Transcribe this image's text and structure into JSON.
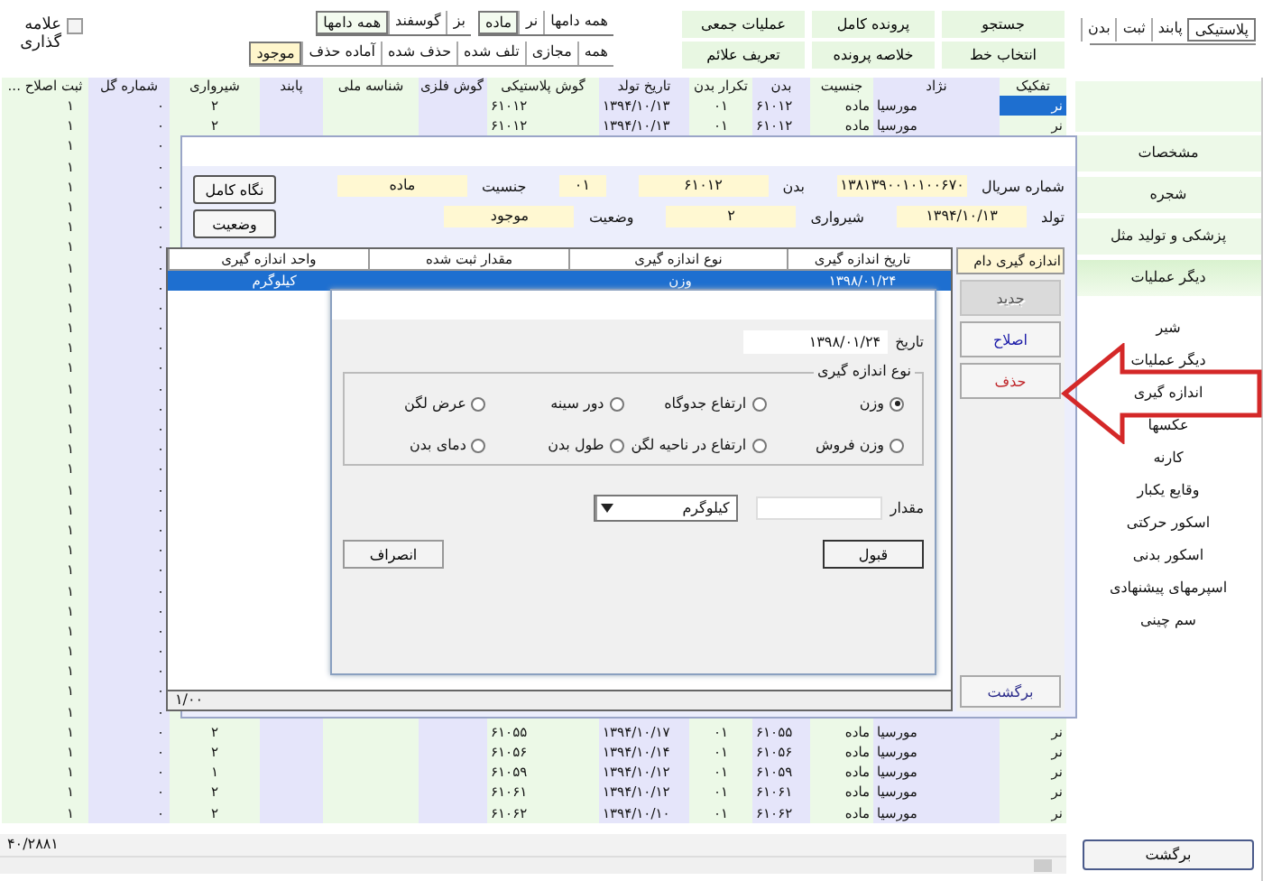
{
  "mark_option": {
    "label": "علامه گذاری",
    "checked": false
  },
  "filter_groups": [
    [
      {
        "label": "همه دامها",
        "selected": false
      },
      {
        "label": "نر",
        "selected": false
      },
      {
        "label": "ماده",
        "selected": true
      }
    ],
    [
      {
        "label": "بز",
        "selected": false
      },
      {
        "label": "گوسفند",
        "selected": false
      },
      {
        "label": "همه دامها",
        "selected": true
      }
    ]
  ],
  "status_tabs": [
    {
      "label": "همه",
      "selected": false
    },
    {
      "label": "مجازی",
      "selected": false
    },
    {
      "label": "تلف شده",
      "selected": false
    },
    {
      "label": "حذف شده",
      "selected": false
    },
    {
      "label": "آماده حذف",
      "selected": false
    },
    {
      "label": "موجود",
      "selected": true
    }
  ],
  "actions": [
    "جستجو",
    "پرونده کامل",
    "عملیات جمعی",
    "انتخاب خط",
    "خلاصه پرونده",
    "تعریف علائم"
  ],
  "view_tabs": [
    {
      "label": "پلاستیکی",
      "selected": true
    },
    {
      "label": "پابند",
      "selected": false
    },
    {
      "label": "ثبت",
      "selected": false
    },
    {
      "label": "بدن",
      "selected": false
    }
  ],
  "grid": {
    "columns": [
      "تفکیک",
      "نژاد",
      "جنسیت",
      "بدن",
      "تکرار بدن",
      "تاریخ تولد",
      "گوش پلاستیکی",
      "گوش فلزی",
      "شناسه ملی",
      "پابند",
      "شیرواری",
      "شماره گل",
      "ثبت اصلاح ..."
    ],
    "rows": [
      {
        "selected": true,
        "cells": [
          "نر",
          "مورسیا",
          "ماده",
          "۶۱۰۱۲",
          "۰۱",
          "۱۳۹۴/۱۰/۱۳",
          "۶۱۰۱۲",
          null,
          null,
          null,
          "۲",
          "۰",
          "۱"
        ]
      },
      {
        "selected": false,
        "cells": [
          "نر",
          "مورسیا",
          "ماده",
          "۶۱۰۱۲",
          "۰۱",
          "۱۳۹۴/۱۰/۱۳",
          "۶۱۰۱۲",
          null,
          null,
          null,
          "۲",
          "۰",
          "۱"
        ]
      },
      {
        "cells": [
          null,
          null,
          null,
          null,
          null,
          null,
          null,
          null,
          null,
          null,
          null,
          "۰",
          "۱"
        ]
      },
      {
        "cells": [
          null,
          null,
          null,
          null,
          null,
          null,
          null,
          null,
          null,
          null,
          null,
          "۰",
          "۱"
        ]
      },
      {
        "cells": [
          null,
          null,
          null,
          null,
          null,
          null,
          null,
          null,
          null,
          null,
          null,
          "۰",
          "۱"
        ]
      },
      {
        "cells": [
          null,
          null,
          null,
          null,
          null,
          null,
          null,
          null,
          null,
          null,
          null,
          "۰",
          "۱"
        ]
      },
      {
        "cells": [
          null,
          null,
          null,
          null,
          null,
          null,
          null,
          null,
          null,
          null,
          null,
          "۰",
          "۱"
        ]
      },
      {
        "cells": [
          null,
          null,
          null,
          null,
          null,
          null,
          null,
          null,
          null,
          null,
          null,
          "۰",
          "۱"
        ]
      },
      {
        "cells": [
          null,
          null,
          null,
          null,
          null,
          null,
          null,
          null,
          null,
          null,
          null,
          "۰",
          "۱"
        ]
      },
      {
        "cells": [
          null,
          null,
          null,
          null,
          null,
          null,
          null,
          null,
          null,
          null,
          null,
          "۰",
          "۱"
        ]
      },
      {
        "cells": [
          null,
          null,
          null,
          null,
          null,
          null,
          null,
          null,
          null,
          null,
          null,
          "۰",
          "۱"
        ]
      },
      {
        "cells": [
          null,
          null,
          null,
          null,
          null,
          null,
          null,
          null,
          null,
          null,
          null,
          "۰",
          "۱"
        ]
      },
      {
        "cells": [
          null,
          null,
          null,
          null,
          null,
          null,
          null,
          null,
          null,
          null,
          null,
          "۰",
          "۱"
        ]
      },
      {
        "cells": [
          null,
          null,
          null,
          null,
          null,
          null,
          null,
          null,
          null,
          null,
          null,
          "۰",
          "۱"
        ]
      },
      {
        "cells": [
          null,
          null,
          null,
          null,
          null,
          null,
          null,
          null,
          null,
          null,
          null,
          "۰",
          "۱"
        ]
      },
      {
        "cells": [
          null,
          null,
          null,
          null,
          null,
          null,
          null,
          null,
          null,
          null,
          null,
          "۰",
          "۱"
        ]
      },
      {
        "cells": [
          null,
          null,
          null,
          null,
          null,
          null,
          null,
          null,
          null,
          null,
          null,
          "۰",
          "۱"
        ]
      },
      {
        "cells": [
          null,
          null,
          null,
          null,
          null,
          null,
          null,
          null,
          null,
          null,
          null,
          "۰",
          "۱"
        ]
      },
      {
        "cells": [
          null,
          null,
          null,
          null,
          null,
          null,
          null,
          null,
          null,
          null,
          null,
          "۰",
          "۱"
        ]
      },
      {
        "cells": [
          null,
          null,
          null,
          null,
          null,
          null,
          null,
          null,
          null,
          null,
          null,
          "۰",
          "۱"
        ]
      },
      {
        "cells": [
          null,
          null,
          null,
          null,
          null,
          null,
          null,
          null,
          null,
          null,
          null,
          "۰",
          "۱"
        ]
      },
      {
        "cells": [
          null,
          null,
          null,
          null,
          null,
          null,
          null,
          null,
          null,
          null,
          null,
          "۰",
          "۱"
        ]
      },
      {
        "cells": [
          null,
          null,
          null,
          null,
          null,
          null,
          null,
          null,
          null,
          null,
          null,
          "۰",
          "۱"
        ]
      },
      {
        "cells": [
          null,
          null,
          null,
          null,
          null,
          null,
          null,
          null,
          null,
          null,
          null,
          "۰",
          "۱"
        ]
      },
      {
        "cells": [
          null,
          null,
          null,
          null,
          null,
          null,
          null,
          null,
          null,
          null,
          null,
          "۰",
          "۱"
        ]
      },
      {
        "cells": [
          null,
          null,
          null,
          null,
          null,
          null,
          null,
          null,
          null,
          null,
          null,
          "۰",
          "۱"
        ]
      },
      {
        "cells": [
          null,
          null,
          null,
          null,
          null,
          null,
          null,
          null,
          null,
          null,
          null,
          "۰",
          "۱"
        ]
      },
      {
        "cells": [
          null,
          null,
          null,
          null,
          null,
          null,
          null,
          null,
          null,
          null,
          null,
          "۰",
          "۱"
        ]
      },
      {
        "cells": [
          null,
          null,
          null,
          null,
          null,
          null,
          null,
          null,
          null,
          null,
          null,
          "۰",
          "۱"
        ]
      },
      {
        "cells": [
          null,
          null,
          null,
          null,
          null,
          null,
          null,
          null,
          null,
          null,
          null,
          "۰",
          "۱"
        ]
      },
      {
        "cells": [
          null,
          null,
          null,
          null,
          null,
          null,
          null,
          null,
          null,
          null,
          null,
          "۰",
          "۱"
        ]
      },
      {
        "selected": false,
        "cells": [
          "نر",
          "مورسیا",
          "ماده",
          "۶۱۰۵۵",
          "۰۱",
          "۱۳۹۴/۱۰/۱۷",
          "۶۱۰۵۵",
          null,
          null,
          null,
          "۲",
          "۰",
          "۱"
        ]
      },
      {
        "selected": false,
        "cells": [
          "نر",
          "مورسیا",
          "ماده",
          "۶۱۰۵۶",
          "۰۱",
          "۱۳۹۴/۱۰/۱۴",
          "۶۱۰۵۶",
          null,
          null,
          null,
          "۲",
          "۰",
          "۱"
        ]
      },
      {
        "selected": false,
        "cells": [
          "نر",
          "مورسیا",
          "ماده",
          "۶۱۰۵۹",
          "۰۱",
          "۱۳۹۴/۱۰/۱۲",
          "۶۱۰۵۹",
          null,
          null,
          null,
          "۱",
          "۰",
          "۱"
        ]
      },
      {
        "selected": false,
        "cells": [
          "نر",
          "مورسیا",
          "ماده",
          "۶۱۰۶۱",
          "۰۱",
          "۱۳۹۴/۱۰/۱۲",
          "۶۱۰۶۱",
          null,
          null,
          null,
          "۲",
          "۰",
          "۱"
        ]
      },
      {
        "selected": false,
        "cells": [
          "نر",
          "مورسیا",
          "ماده",
          "۶۱۰۶۲",
          "۰۱",
          "۱۳۹۴/۱۰/۱۰",
          "۶۱۰۶۲",
          null,
          null,
          null,
          "۲",
          "۰",
          "۱"
        ]
      }
    ]
  },
  "record_count": "۴۰/۲۸۸۱",
  "sidebar": [
    {
      "kind": "section",
      "label": "مشخصات",
      "selected": false
    },
    {
      "kind": "section",
      "label": "شجره",
      "selected": false
    },
    {
      "kind": "section",
      "label": "پزشکی و تولید مثل",
      "selected": false
    },
    {
      "kind": "section",
      "label": "دیگر عملیات",
      "selected": true
    },
    {
      "kind": "item",
      "label": "شیر"
    },
    {
      "kind": "item",
      "label": "دیگر عملیات"
    },
    {
      "kind": "item",
      "label": "اندازه گیری"
    },
    {
      "kind": "item",
      "label": "عکسها"
    },
    {
      "kind": "item",
      "label": "کارنه"
    },
    {
      "kind": "item",
      "label": "وقایع یکبار"
    },
    {
      "kind": "item",
      "label": "اسکور حرکتی"
    },
    {
      "kind": "item",
      "label": "اسکور بدنی"
    },
    {
      "kind": "item",
      "label": "اسپرمهای پیشنهادی"
    },
    {
      "kind": "item",
      "label": "سم چینی"
    }
  ],
  "back_button": "برگشت",
  "dialog": {
    "fields": [
      [
        {
          "label": "شماره سریال",
          "value": "۱۳۸۱۳۹۰۰۱۰۱۰۰۶۷۰"
        },
        {
          "label": "بدن",
          "value": "۶۱۰۱۲",
          "extra": "۰۱"
        },
        {
          "label": "جنسیت",
          "value": "ماده"
        }
      ],
      [
        {
          "label": "تولد",
          "value": "۱۳۹۴/۱۰/۱۳"
        },
        {
          "label": "شیرواری",
          "value": "۲"
        },
        {
          "label": "وضعیت",
          "value": "موجود"
        }
      ]
    ],
    "side_buttons": [
      "نگاه کامل",
      "وضعیت"
    ],
    "table": {
      "columns": [
        "تاریخ اندازه گیری",
        "نوع اندازه گیری",
        "مقدار ثبت شده",
        "واحد اندازه گیری"
      ],
      "rows": [
        {
          "selected": true,
          "cells": [
            "۱۳۹۸/۰۱/۲۴",
            "وزن",
            null,
            "کیلوگرم"
          ]
        }
      ]
    },
    "counter": "۱/۰۰",
    "tab": "اندازه گیری دام",
    "actions": [
      {
        "label": "جدید",
        "disabled": true,
        "color": "#555555"
      },
      {
        "label": "اصلاح",
        "disabled": false,
        "color": "#1a1aa8"
      },
      {
        "label": "حذف",
        "disabled": false,
        "color": "#c0282c"
      }
    ],
    "back_button": "برگشت",
    "entry": {
      "date_label": "تاریخ",
      "date": "۱۳۹۸/۰۱/۲۴",
      "group_label": "نوع اندازه گیری",
      "options": [
        {
          "label": "وزن",
          "selected": true
        },
        {
          "label": "ارتفاع جدوگاه",
          "selected": false
        },
        {
          "label": "دور سینه",
          "selected": false
        },
        {
          "label": "عرض لگن",
          "selected": false
        },
        {
          "label": "وزن فروش",
          "selected": false
        },
        {
          "label": "ارتفاع در ناحیه لگن",
          "selected": false
        },
        {
          "label": "طول بدن",
          "selected": false
        },
        {
          "label": "دمای بدن",
          "selected": false
        }
      ],
      "amount_label": "مقدار",
      "unit": "کیلوگرم",
      "ok": "قبول",
      "cancel": "انصراف"
    }
  }
}
